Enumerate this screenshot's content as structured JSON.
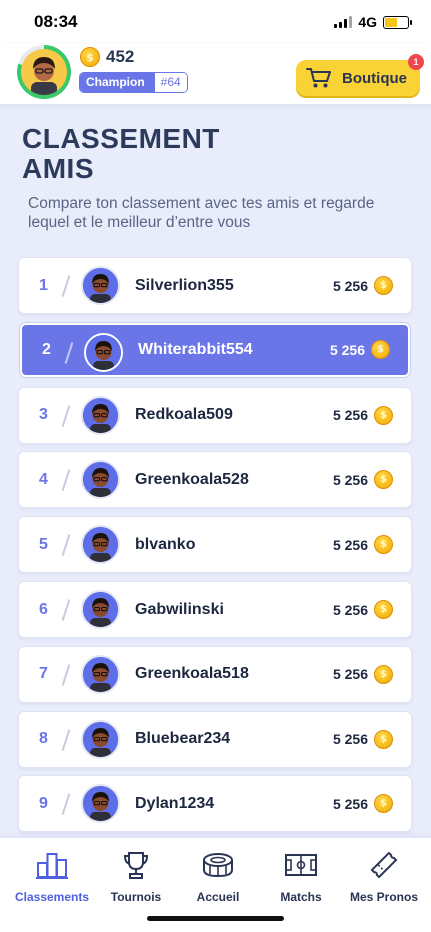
{
  "status_bar": {
    "time": "08:34",
    "network": "4G",
    "battery_level": 0.55,
    "battery_color": "#f5c518"
  },
  "header": {
    "coins": "452",
    "rank_label": "Champion",
    "rank_number": "#64",
    "shop_label": "Boutique",
    "shop_badge": "1",
    "progress": 0.8
  },
  "page": {
    "title": "CLASSEMENT AMIS",
    "subtitle": "Compare ton classement avec tes amis et regarde lequel et le meilleur d’entre vous"
  },
  "leaderboard": [
    {
      "rank": "1",
      "name": "Silverlion355",
      "score": "5 256",
      "active": false
    },
    {
      "rank": "2",
      "name": "Whiterabbit554",
      "score": "5 256",
      "active": true
    },
    {
      "rank": "3",
      "name": "Redkoala509",
      "score": "5 256",
      "active": false
    },
    {
      "rank": "4",
      "name": "Greenkoala528",
      "score": "5 256",
      "active": false
    },
    {
      "rank": "5",
      "name": "blvanko",
      "score": "5 256",
      "active": false
    },
    {
      "rank": "6",
      "name": "Gabwilinski",
      "score": "5 256",
      "active": false
    },
    {
      "rank": "7",
      "name": "Greenkoala518",
      "score": "5 256",
      "active": false
    },
    {
      "rank": "8",
      "name": "Bluebear234",
      "score": "5 256",
      "active": false
    },
    {
      "rank": "9",
      "name": "Dylan1234",
      "score": "5 256",
      "active": false
    }
  ],
  "bottom_nav": [
    {
      "label": "Classements",
      "icon": "podium-icon",
      "active": true
    },
    {
      "label": "Tournois",
      "icon": "trophy-icon",
      "active": false
    },
    {
      "label": "Accueil",
      "icon": "stadium-icon",
      "active": false
    },
    {
      "label": "Matchs",
      "icon": "field-icon",
      "active": false
    },
    {
      "label": "Mes Pronos",
      "icon": "ticket-icon",
      "active": false
    }
  ],
  "colors": {
    "accent": "#6a75e8",
    "background": "#e8ecfb",
    "shop": "#f9d235",
    "coin": "#f2a900",
    "progress": "#39c86a"
  }
}
